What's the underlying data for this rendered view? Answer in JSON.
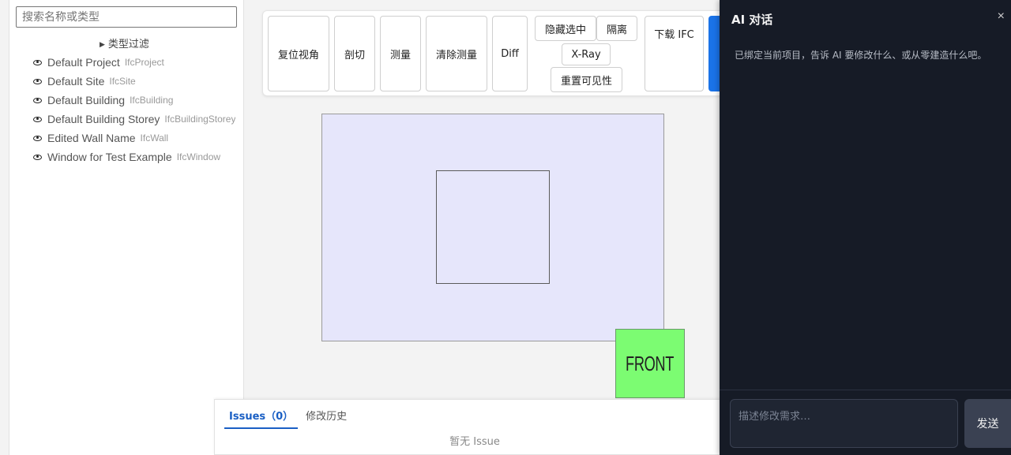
{
  "tree_panel": {
    "search_placeholder": "搜索名称或类型",
    "filter_label": "类型过滤",
    "items": [
      {
        "name": "Default Project",
        "type": "IfcProject"
      },
      {
        "name": "Default Site",
        "type": "IfcSite"
      },
      {
        "name": "Default Building",
        "type": "IfcBuilding"
      },
      {
        "name": "Default Building Storey",
        "type": "IfcBuildingStorey"
      },
      {
        "name": "Edited Wall Name",
        "type": "IfcWall"
      },
      {
        "name": "Window for Test Example",
        "type": "IfcWindow"
      }
    ]
  },
  "toolbar": {
    "reset_view": "复位视角",
    "section": "剖切",
    "measure": "测量",
    "clear_measure": "清除测量",
    "diff": "Diff",
    "hide_selected": "隐藏选中",
    "isolate": "隔离",
    "xray": "X-Ray",
    "reset_visibility": "重置可见性",
    "download_ifc": "下载 IFC"
  },
  "viewport": {
    "view_cube_label": "FRONT"
  },
  "bottom_panel": {
    "tab_issues": "Issues（0）",
    "tab_history": "修改历史",
    "empty_text": "暂无 Issue"
  },
  "ai_chat": {
    "title": "AI 对话",
    "close": "×",
    "hint": "已绑定当前项目，告诉 AI 要修改什么、或从零建造什么吧。",
    "input_placeholder": "描述修改需求…",
    "send": "发送"
  },
  "colors": {
    "primary": "#1a73e8",
    "chat_background": "#161b26",
    "viewport_fill": "#e6e6fb",
    "view_cube": "#7cfc72",
    "active_tab": "#1a5fc4"
  }
}
